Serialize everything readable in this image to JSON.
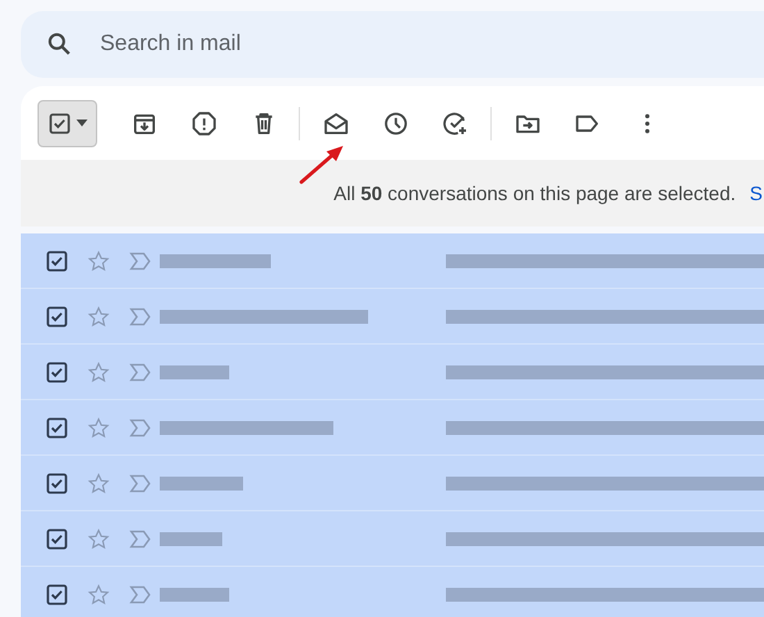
{
  "search": {
    "placeholder": "Search in mail"
  },
  "toolbar": {
    "select_all": {
      "checked": true
    }
  },
  "selection_banner": {
    "message": "All **50** conversations on this page are selected.",
    "link": "S"
  },
  "rows": [
    {
      "checked": true,
      "starred": false,
      "important": false
    },
    {
      "checked": true,
      "starred": false,
      "important": false
    },
    {
      "checked": true,
      "starred": false,
      "important": false
    },
    {
      "checked": true,
      "starred": false,
      "important": false
    },
    {
      "checked": true,
      "starred": false,
      "important": false
    },
    {
      "checked": true,
      "starred": false,
      "important": false
    },
    {
      "checked": true,
      "starred": false,
      "important": false
    }
  ]
}
